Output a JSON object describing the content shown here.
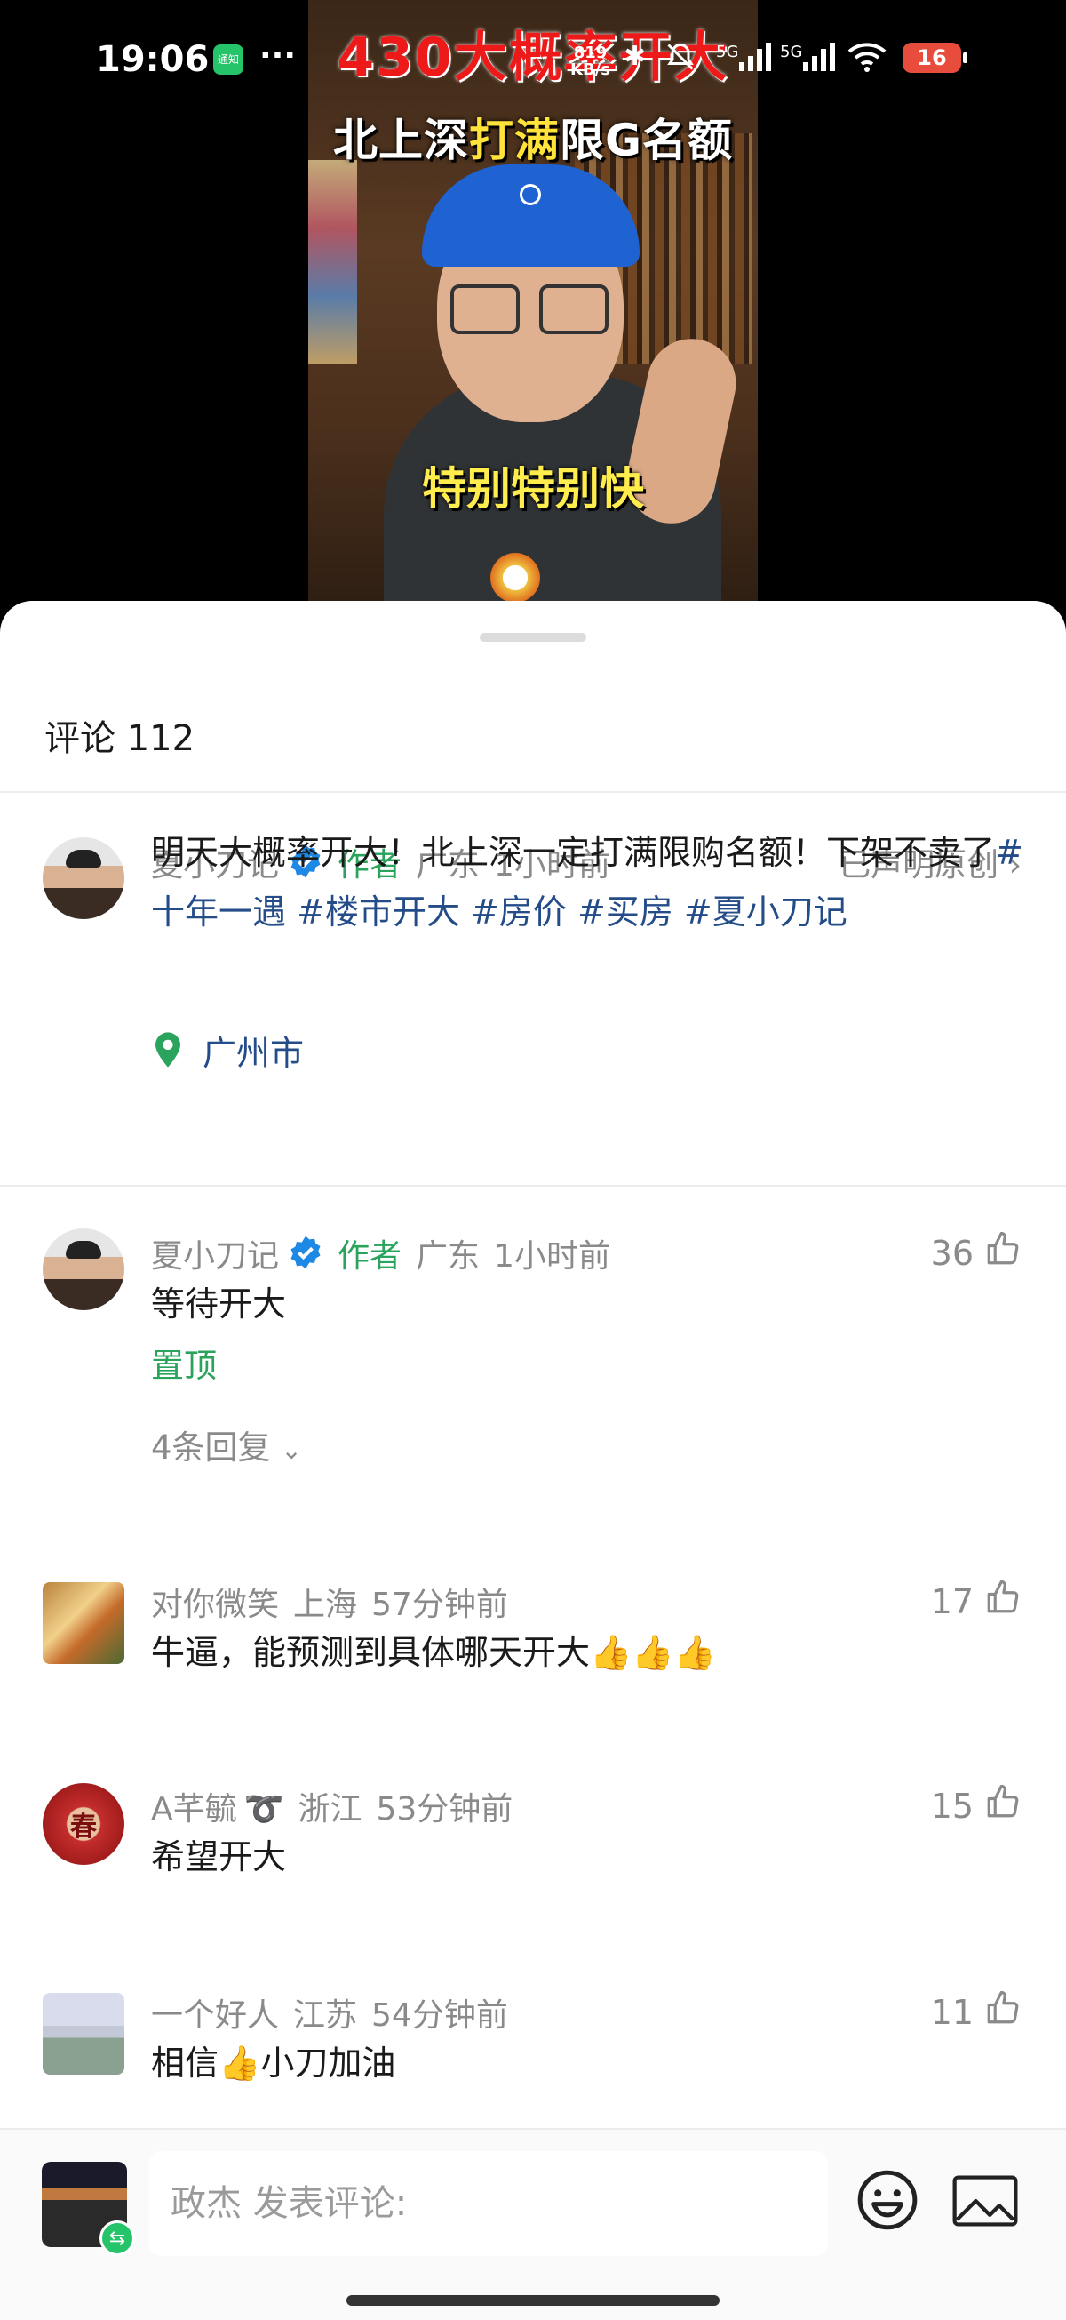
{
  "status_bar": {
    "time": "19:06",
    "app_badge": "通知",
    "more": "···",
    "net_speed_value": "819",
    "net_speed_unit": "KB/s",
    "bluetooth": "✱",
    "signal_1": "5G",
    "signal_2": "5G",
    "battery": "16"
  },
  "video": {
    "title_line1": "430大概率开大",
    "title_line2_pre": "北上深",
    "title_line2_hl": "打满",
    "title_line2_post": "限G名额",
    "subtitle": "特别特别快"
  },
  "sheet": {
    "title": "评论 112"
  },
  "post": {
    "author": "夏小刀记",
    "author_tag": "作者",
    "region": "广东",
    "time": "1小时前",
    "original_label": "已声明原创",
    "text_plain": "明天大概率开大！北上深一定打满限购名额！下架不卖了",
    "hashtags": [
      "#十年一遇",
      "#楼市开大",
      "#房价",
      "#买房",
      "#夏小刀记"
    ],
    "location": "广州市"
  },
  "comments": [
    {
      "user": "夏小刀记",
      "tag": "作者",
      "region": "广东",
      "time": "1小时前",
      "text": "等待开大",
      "likes": "36",
      "pinned": "置顶",
      "replies": "4条回复"
    },
    {
      "user": "对你微笑",
      "region": "上海",
      "time": "57分钟前",
      "text": "牛逼，能预测到具体哪天开大👍👍👍",
      "likes": "17"
    },
    {
      "user": "A芊毓",
      "user_emoji": "➰",
      "region": "浙江",
      "time": "53分钟前",
      "text": "希望开大",
      "likes": "15"
    },
    {
      "user": "一个好人",
      "region": "江苏",
      "time": "54分钟前",
      "text": "相信👍小刀加油",
      "likes": "11"
    }
  ],
  "bottom_bar": {
    "input_placeholder": "政杰 发表评论:",
    "switch_icon": "⇆"
  }
}
